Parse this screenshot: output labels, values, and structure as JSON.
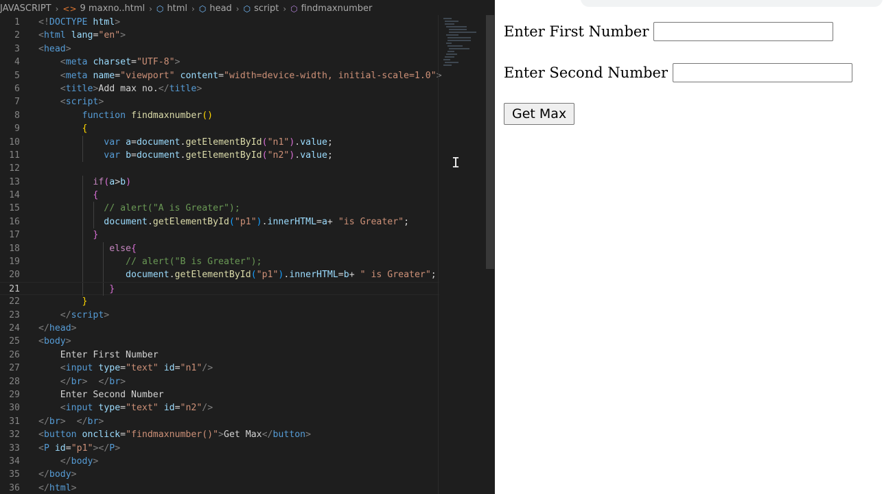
{
  "breadcrumb": {
    "items": [
      {
        "label": "JAVASCRIPT",
        "icon": ""
      },
      {
        "label": "9 maxno..html",
        "icon": "html-file-icon"
      },
      {
        "label": "html",
        "icon": "cube-icon"
      },
      {
        "label": "head",
        "icon": "cube-icon"
      },
      {
        "label": "script",
        "icon": "cube-icon"
      },
      {
        "label": "findmaxnumber",
        "icon": "function-icon"
      }
    ]
  },
  "editor": {
    "active_line": 21,
    "lines": [
      {
        "n": "1",
        "tokens": [
          [
            "t-br",
            "<!"
          ],
          [
            "t-tag",
            "DOCTYPE"
          ],
          [
            "t-txt",
            " "
          ],
          [
            "t-attr",
            "html"
          ],
          [
            "t-br",
            ">"
          ]
        ]
      },
      {
        "n": "2",
        "tokens": [
          [
            "t-br",
            "<"
          ],
          [
            "t-tag",
            "html"
          ],
          [
            "t-txt",
            " "
          ],
          [
            "t-attr",
            "lang"
          ],
          [
            "t-txt",
            "="
          ],
          [
            "t-str",
            "\"en\""
          ],
          [
            "t-br",
            ">"
          ]
        ]
      },
      {
        "n": "3",
        "tokens": [
          [
            "t-br",
            "<"
          ],
          [
            "t-tag",
            "head"
          ],
          [
            "t-br",
            ">"
          ]
        ]
      },
      {
        "n": "4",
        "tokens": [
          [
            "t-txt",
            "    "
          ],
          [
            "t-br",
            "<"
          ],
          [
            "t-tag",
            "meta"
          ],
          [
            "t-txt",
            " "
          ],
          [
            "t-attr",
            "charset"
          ],
          [
            "t-txt",
            "="
          ],
          [
            "t-str",
            "\"UTF-8\""
          ],
          [
            "t-br",
            ">"
          ]
        ]
      },
      {
        "n": "5",
        "tokens": [
          [
            "t-txt",
            "    "
          ],
          [
            "t-br",
            "<"
          ],
          [
            "t-tag",
            "meta"
          ],
          [
            "t-txt",
            " "
          ],
          [
            "t-attr",
            "name"
          ],
          [
            "t-txt",
            "="
          ],
          [
            "t-str",
            "\"viewport\""
          ],
          [
            "t-txt",
            " "
          ],
          [
            "t-attr",
            "content"
          ],
          [
            "t-txt",
            "="
          ],
          [
            "t-str",
            "\"width=device-width, initial-scale=1.0\""
          ],
          [
            "t-br",
            ">"
          ]
        ]
      },
      {
        "n": "6",
        "tokens": [
          [
            "t-txt",
            "    "
          ],
          [
            "t-br",
            "<"
          ],
          [
            "t-tag",
            "title"
          ],
          [
            "t-br",
            ">"
          ],
          [
            "t-txt",
            "Add max no."
          ],
          [
            "t-br",
            "</"
          ],
          [
            "t-tag",
            "title"
          ],
          [
            "t-br",
            ">"
          ]
        ]
      },
      {
        "n": "7",
        "tokens": [
          [
            "t-txt",
            "    "
          ],
          [
            "t-br",
            "<"
          ],
          [
            "t-tag",
            "script"
          ],
          [
            "t-br",
            ">"
          ]
        ]
      },
      {
        "n": "8",
        "tokens": [
          [
            "t-txt",
            "        "
          ],
          [
            "t-kw",
            "function"
          ],
          [
            "t-txt",
            " "
          ],
          [
            "t-fn",
            "findmaxnumber"
          ],
          [
            "t-b1",
            "()"
          ]
        ]
      },
      {
        "n": "9",
        "tokens": [
          [
            "t-txt",
            "        "
          ],
          [
            "t-b1",
            "{"
          ]
        ]
      },
      {
        "n": "10",
        "tokens": [
          [
            "t-txt",
            "            "
          ],
          [
            "t-kw",
            "var"
          ],
          [
            "t-txt",
            " "
          ],
          [
            "t-var",
            "a"
          ],
          [
            "t-txt",
            "="
          ],
          [
            "t-var",
            "document"
          ],
          [
            "t-txt",
            "."
          ],
          [
            "t-fn",
            "getElementById"
          ],
          [
            "t-b2",
            "("
          ],
          [
            "t-str",
            "\"n1\""
          ],
          [
            "t-b2",
            ")"
          ],
          [
            "t-txt",
            "."
          ],
          [
            "t-var",
            "value"
          ],
          [
            "t-txt",
            ";"
          ]
        ]
      },
      {
        "n": "11",
        "tokens": [
          [
            "t-txt",
            "            "
          ],
          [
            "t-kw",
            "var"
          ],
          [
            "t-txt",
            " "
          ],
          [
            "t-var",
            "b"
          ],
          [
            "t-txt",
            "="
          ],
          [
            "t-var",
            "document"
          ],
          [
            "t-txt",
            "."
          ],
          [
            "t-fn",
            "getElementById"
          ],
          [
            "t-b2",
            "("
          ],
          [
            "t-str",
            "\"n2\""
          ],
          [
            "t-b2",
            ")"
          ],
          [
            "t-txt",
            "."
          ],
          [
            "t-var",
            "value"
          ],
          [
            "t-txt",
            ";"
          ]
        ]
      },
      {
        "n": "12",
        "tokens": []
      },
      {
        "n": "13",
        "tokens": [
          [
            "t-txt",
            "          "
          ],
          [
            "t-ctl",
            "if"
          ],
          [
            "t-b2",
            "("
          ],
          [
            "t-var",
            "a"
          ],
          [
            "t-txt",
            ">"
          ],
          [
            "t-var",
            "b"
          ],
          [
            "t-b2",
            ")"
          ]
        ]
      },
      {
        "n": "14",
        "tokens": [
          [
            "t-txt",
            "          "
          ],
          [
            "t-b2",
            "{"
          ]
        ]
      },
      {
        "n": "15",
        "tokens": [
          [
            "t-txt",
            "            "
          ],
          [
            "t-com",
            "// alert(\"A is Greater\");"
          ]
        ]
      },
      {
        "n": "16",
        "tokens": [
          [
            "t-txt",
            "            "
          ],
          [
            "t-var",
            "document"
          ],
          [
            "t-txt",
            "."
          ],
          [
            "t-fn",
            "getElementById"
          ],
          [
            "t-b3",
            "("
          ],
          [
            "t-str",
            "\"p1\""
          ],
          [
            "t-b3",
            ")"
          ],
          [
            "t-txt",
            "."
          ],
          [
            "t-var",
            "innerHTML"
          ],
          [
            "t-txt",
            "="
          ],
          [
            "t-var",
            "a"
          ],
          [
            "t-txt",
            "+ "
          ],
          [
            "t-str",
            "\"is Greater\""
          ],
          [
            "t-txt",
            ";"
          ]
        ]
      },
      {
        "n": "17",
        "tokens": [
          [
            "t-txt",
            "          "
          ],
          [
            "t-b2",
            "}"
          ]
        ]
      },
      {
        "n": "18",
        "tokens": [
          [
            "t-txt",
            "             "
          ],
          [
            "t-ctl",
            "else"
          ],
          [
            "t-b2",
            "{"
          ]
        ]
      },
      {
        "n": "19",
        "tokens": [
          [
            "t-txt",
            "                "
          ],
          [
            "t-com",
            "// alert(\"B is Greater\");"
          ]
        ]
      },
      {
        "n": "20",
        "tokens": [
          [
            "t-txt",
            "                "
          ],
          [
            "t-var",
            "document"
          ],
          [
            "t-txt",
            "."
          ],
          [
            "t-fn",
            "getElementById"
          ],
          [
            "t-b3",
            "("
          ],
          [
            "t-str",
            "\"p1\""
          ],
          [
            "t-b3",
            ")"
          ],
          [
            "t-txt",
            "."
          ],
          [
            "t-var",
            "innerHTML"
          ],
          [
            "t-txt",
            "="
          ],
          [
            "t-var",
            "b"
          ],
          [
            "t-txt",
            "+ "
          ],
          [
            "t-str",
            "\" is Greater\""
          ],
          [
            "t-txt",
            ";"
          ]
        ]
      },
      {
        "n": "21",
        "tokens": [
          [
            "t-txt",
            "             "
          ],
          [
            "t-b2",
            "}"
          ]
        ]
      },
      {
        "n": "22",
        "tokens": [
          [
            "t-txt",
            "        "
          ],
          [
            "t-b1",
            "}"
          ]
        ]
      },
      {
        "n": "23",
        "tokens": [
          [
            "t-txt",
            "    "
          ],
          [
            "t-br",
            "</"
          ],
          [
            "t-tag",
            "script"
          ],
          [
            "t-br",
            ">"
          ]
        ]
      },
      {
        "n": "24",
        "tokens": [
          [
            "t-br",
            "</"
          ],
          [
            "t-tag",
            "head"
          ],
          [
            "t-br",
            ">"
          ]
        ]
      },
      {
        "n": "25",
        "tokens": [
          [
            "t-br",
            "<"
          ],
          [
            "t-tag",
            "body"
          ],
          [
            "t-br",
            ">"
          ]
        ]
      },
      {
        "n": "26",
        "tokens": [
          [
            "t-txt",
            "    Enter First Number"
          ]
        ]
      },
      {
        "n": "27",
        "tokens": [
          [
            "t-txt",
            "    "
          ],
          [
            "t-br",
            "<"
          ],
          [
            "t-tag",
            "input"
          ],
          [
            "t-txt",
            " "
          ],
          [
            "t-attr",
            "type"
          ],
          [
            "t-txt",
            "="
          ],
          [
            "t-str",
            "\"text\""
          ],
          [
            "t-txt",
            " "
          ],
          [
            "t-attr",
            "id"
          ],
          [
            "t-txt",
            "="
          ],
          [
            "t-str",
            "\"n1\""
          ],
          [
            "t-br",
            "/>"
          ]
        ]
      },
      {
        "n": "28",
        "tokens": [
          [
            "t-txt",
            "    "
          ],
          [
            "t-br",
            "</"
          ],
          [
            "t-tag",
            "br"
          ],
          [
            "t-br",
            ">"
          ],
          [
            "t-txt",
            "  "
          ],
          [
            "t-br",
            "</"
          ],
          [
            "t-tag",
            "br"
          ],
          [
            "t-br",
            ">"
          ]
        ]
      },
      {
        "n": "29",
        "tokens": [
          [
            "t-txt",
            "    Enter Second Number"
          ]
        ]
      },
      {
        "n": "30",
        "tokens": [
          [
            "t-txt",
            "    "
          ],
          [
            "t-br",
            "<"
          ],
          [
            "t-tag",
            "input"
          ],
          [
            "t-txt",
            " "
          ],
          [
            "t-attr",
            "type"
          ],
          [
            "t-txt",
            "="
          ],
          [
            "t-str",
            "\"text\""
          ],
          [
            "t-txt",
            " "
          ],
          [
            "t-attr",
            "id"
          ],
          [
            "t-txt",
            "="
          ],
          [
            "t-str",
            "\"n2\""
          ],
          [
            "t-br",
            "/>"
          ]
        ]
      },
      {
        "n": "31",
        "tokens": [
          [
            "t-br",
            "</"
          ],
          [
            "t-tag",
            "br"
          ],
          [
            "t-br",
            ">"
          ],
          [
            "t-txt",
            "  "
          ],
          [
            "t-br",
            "</"
          ],
          [
            "t-tag",
            "br"
          ],
          [
            "t-br",
            ">"
          ]
        ]
      },
      {
        "n": "32",
        "tokens": [
          [
            "t-br",
            "<"
          ],
          [
            "t-tag",
            "button"
          ],
          [
            "t-txt",
            " "
          ],
          [
            "t-attr",
            "onclick"
          ],
          [
            "t-txt",
            "="
          ],
          [
            "t-str",
            "\"findmaxnumber()\""
          ],
          [
            "t-br",
            ">"
          ],
          [
            "t-txt",
            "Get Max"
          ],
          [
            "t-br",
            "</"
          ],
          [
            "t-tag",
            "button"
          ],
          [
            "t-br",
            ">"
          ]
        ]
      },
      {
        "n": "33",
        "tokens": [
          [
            "t-br",
            "<"
          ],
          [
            "t-tag",
            "P"
          ],
          [
            "t-txt",
            " "
          ],
          [
            "t-attr",
            "id"
          ],
          [
            "t-txt",
            "="
          ],
          [
            "t-str",
            "\"p1\""
          ],
          [
            "t-br",
            "></"
          ],
          [
            "t-tag",
            "P"
          ],
          [
            "t-br",
            ">"
          ]
        ]
      },
      {
        "n": "34",
        "tokens": [
          [
            "t-txt",
            "    "
          ],
          [
            "t-br",
            "</"
          ],
          [
            "t-tag",
            "body"
          ],
          [
            "t-br",
            ">"
          ]
        ]
      },
      {
        "n": "35",
        "tokens": [
          [
            "t-br",
            "</"
          ],
          [
            "t-tag",
            "body"
          ],
          [
            "t-br",
            ">"
          ]
        ]
      },
      {
        "n": "36",
        "tokens": [
          [
            "t-br",
            "</"
          ],
          [
            "t-tag",
            "html"
          ],
          [
            "t-br",
            ">"
          ]
        ]
      }
    ]
  },
  "browser": {
    "first_label": "Enter First Number",
    "second_label": "Enter Second Number",
    "first_value": "",
    "second_value": "",
    "button_label": "Get Max"
  },
  "colors": {
    "editor_bg": "#1e1e1e",
    "browser_bg": "#ffffff"
  }
}
